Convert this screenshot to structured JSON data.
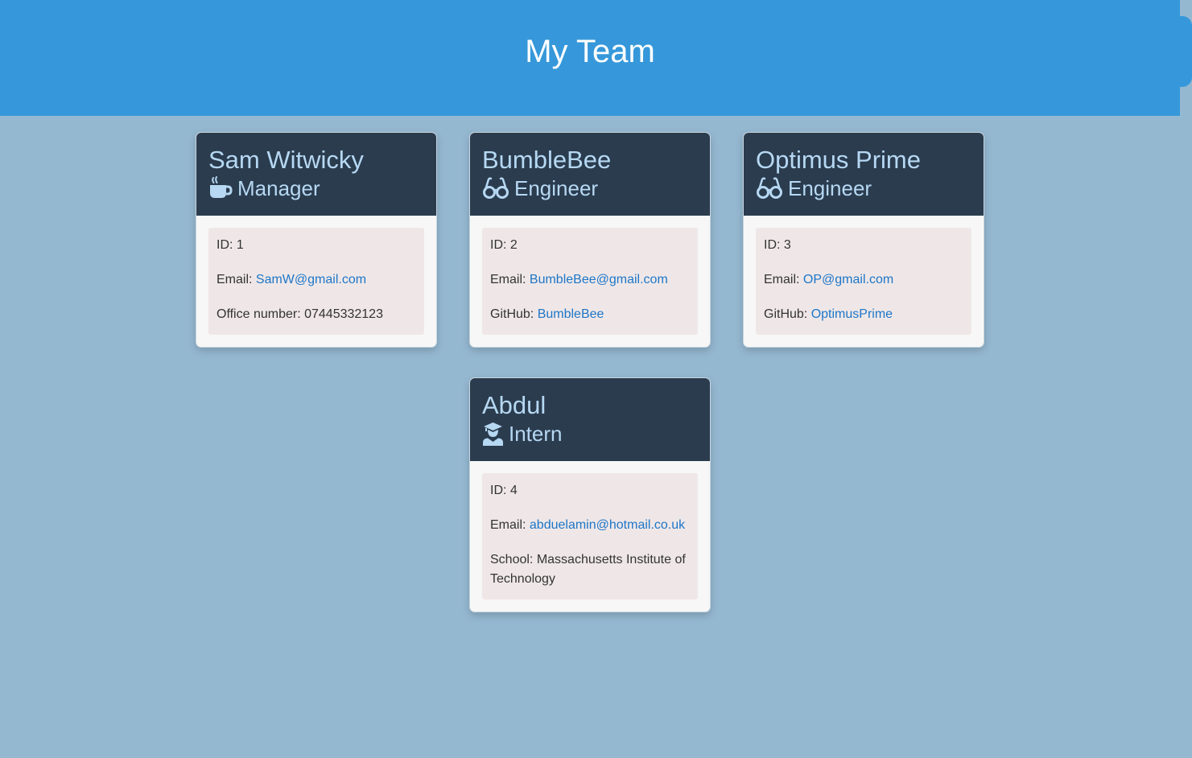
{
  "header": {
    "title": "My Team"
  },
  "team": [
    {
      "name": "Sam Witwicky",
      "role": "Manager",
      "role_icon": "coffee-icon",
      "id_label": "ID:",
      "id_value": "1",
      "email_label": "Email:",
      "email_value": "SamW@gmail.com",
      "extra_label": "Office number:",
      "extra_value": "07445332123"
    },
    {
      "name": "BumbleBee",
      "role": "Engineer",
      "role_icon": "glasses-icon",
      "id_label": "ID:",
      "id_value": "2",
      "email_label": "Email:",
      "email_value": "BumbleBee@gmail.com",
      "extra_label": "GitHub:",
      "extra_value": "BumbleBee"
    },
    {
      "name": "Optimus Prime",
      "role": "Engineer",
      "role_icon": "glasses-icon",
      "id_label": "ID:",
      "id_value": "3",
      "email_label": "Email:",
      "email_value": "OP@gmail.com",
      "extra_label": "GitHub:",
      "extra_value": "OptimusPrime"
    },
    {
      "name": "Abdul",
      "role": "Intern",
      "role_icon": "graduate-icon",
      "id_label": "ID:",
      "id_value": "4",
      "email_label": "Email:",
      "email_value": "abduelamin@hotmail.co.uk",
      "extra_label": "School:",
      "extra_value": "Massachusetts Institute of Technology"
    }
  ],
  "colors": {
    "page_background": "#95b8d1",
    "header_background": "#3698da",
    "card_header_background": "#2b3c4f",
    "card_header_text": "#b6d8f2",
    "link": "#1e76c8"
  }
}
